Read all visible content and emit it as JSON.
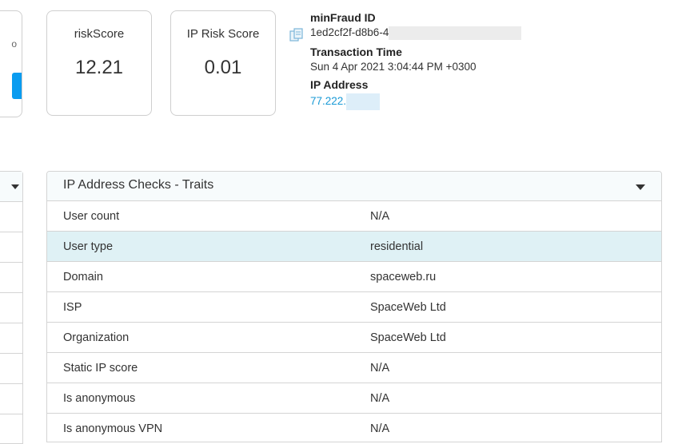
{
  "scores": [
    {
      "label": "riskScore",
      "value": "12.21"
    },
    {
      "label": "IP Risk Score",
      "value": "0.01"
    }
  ],
  "info": {
    "minfraud_id_label": "minFraud ID",
    "minfraud_id_value": "1ed2cf2f-d8b6-4",
    "transaction_time_label": "Transaction Time",
    "transaction_time_value": "Sun 4 Apr 2021 3:04:44 PM +0300",
    "ip_address_label": "IP Address",
    "ip_address_value": "77.222."
  },
  "left_card": {
    "edge_glyph": "o"
  },
  "panel": {
    "title": "IP Address Checks - Traits",
    "rows": [
      {
        "key": "User count",
        "value": "N/A"
      },
      {
        "key": "User type",
        "value": "residential"
      },
      {
        "key": "Domain",
        "value": "spaceweb.ru"
      },
      {
        "key": "ISP",
        "value": "SpaceWeb Ltd"
      },
      {
        "key": "Organization",
        "value": "SpaceWeb Ltd"
      },
      {
        "key": "Static IP score",
        "value": "N/A"
      },
      {
        "key": "Is anonymous",
        "value": "N/A"
      },
      {
        "key": "Is anonymous VPN",
        "value": "N/A"
      }
    ]
  },
  "colors": {
    "accent_blue": "#0a9cf0",
    "link": "#1a9ad6",
    "row_highlight": "#dff1f5",
    "border": "#d4d4d4"
  }
}
